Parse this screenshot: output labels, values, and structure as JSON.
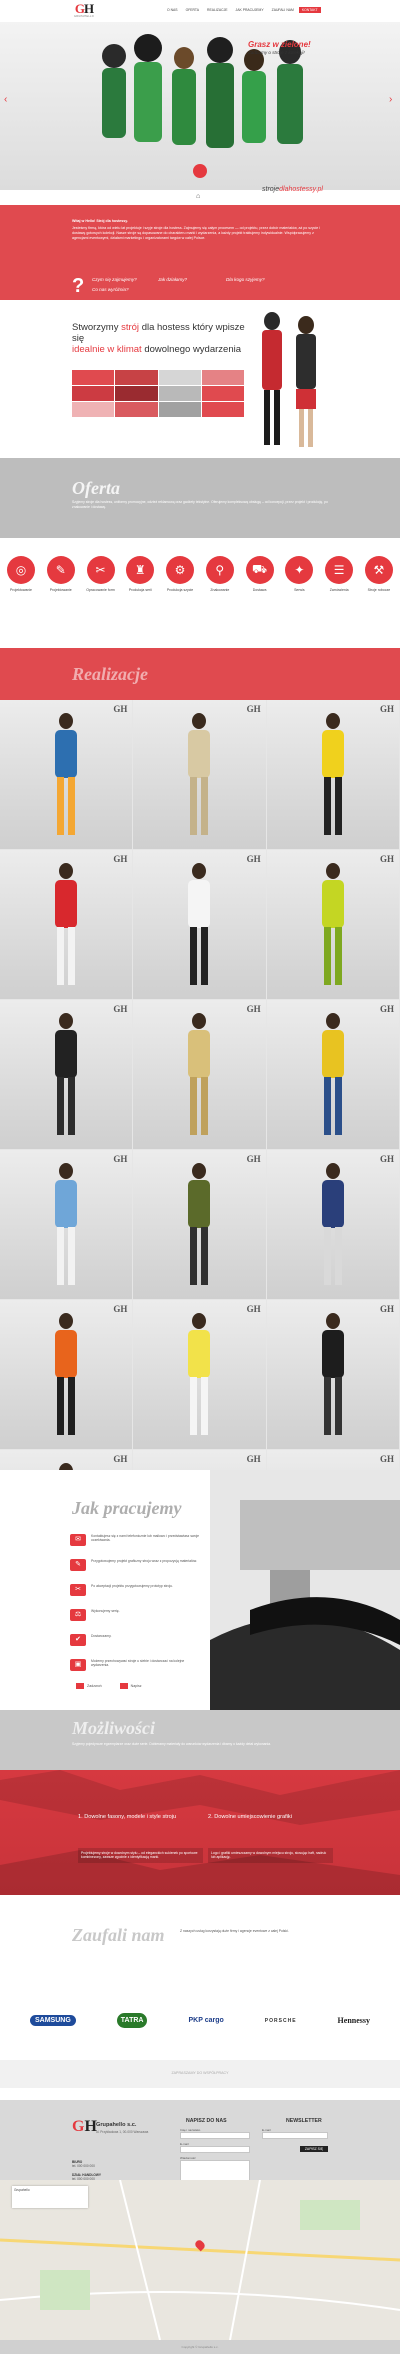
{
  "header": {
    "logo_mark_g": "G",
    "logo_mark_h": "H",
    "logo_sub": "GRUPAHELLO",
    "nav": [
      {
        "label": "O NAS",
        "active": false
      },
      {
        "label": "OFERTA",
        "active": false
      },
      {
        "label": "REALIZACJE",
        "active": false
      },
      {
        "label": "JAK PRACUJEMY",
        "active": false
      },
      {
        "label": "ZAUFALI NAM",
        "active": false
      },
      {
        "label": "KONTAKT",
        "active": true
      }
    ]
  },
  "hero": {
    "tagline_1": "Grasz w zielone!",
    "tagline_2": "Zadbamy o stroje z kolekcji!",
    "url_prefix": "stroje",
    "url_domain": "dlahostessy.pl",
    "colors": {
      "accent": "#e5393f"
    }
  },
  "intro": {
    "heading": "Witaj w Hello! Strój dla hostessy.",
    "body": "Jesteśmy firmą, która od wielu lat projektuje i szyje stroje dla hostess. Zajmujemy się całym procesem — od projektu, przez dobór materiałów, aż po szycie i dostawę gotowych kolekcji. Nasze stroje są dopasowane do charakteru marki i wydarzenia, a każdy projekt traktujemy indywidualnie. Współpracujemy z agencjami eventowymi, działami marketingu i organizatorami targów w całej Polsce.",
    "questions": [
      "Czym się zajmujemy?",
      "Jak działamy?",
      "Dla kogo szyjemy?",
      "Co nas wyróżnia?"
    ]
  },
  "tailor": {
    "title_1": "Stworzymy",
    "title_hl_1": "strój",
    "title_2": "dla hostess który wpisze się",
    "title_hl_2": "idealnie w klimat",
    "title_3": "dowolnego wydarzenia",
    "swatches": [
      "#e04a4f",
      "#c74245",
      "#d6d6d6",
      "#e58285",
      "#cc3b42",
      "#9a2b30",
      "#b9b9b9",
      "#e04a4f",
      "#efb2b4",
      "#d95a5f",
      "#a1a1a1",
      "#e04a4f"
    ]
  },
  "oferta": {
    "title": "Oferta",
    "body": "Szyjemy stroje dla hostess, uniformy promocyjne, odzież reklamową oraz gadżety tekstylne. Oferujemy kompleksową obsługę – od koncepcji, przez projekt i produkcję, po znakowanie i dostawę."
  },
  "offer_icons": [
    {
      "icon": "lifebuoy-icon",
      "glyph": "◎",
      "label": "Projektowanie"
    },
    {
      "icon": "pencil-icon",
      "glyph": "✎",
      "label": "Projektowanie"
    },
    {
      "icon": "scissors-icon",
      "glyph": "✂",
      "label": "Opracowanie form"
    },
    {
      "icon": "mannequin-icon",
      "glyph": "♜",
      "label": "Produkcja serii"
    },
    {
      "icon": "sewing-machine-icon",
      "glyph": "⚙",
      "label": "Produkcja szycie"
    },
    {
      "icon": "stamp-icon",
      "glyph": "⚲",
      "label": "Znakowanie"
    },
    {
      "icon": "delivery-icon",
      "glyph": "⛟",
      "label": "Dostawa"
    },
    {
      "icon": "pin-icon",
      "glyph": "✦",
      "label": "Serwis"
    },
    {
      "icon": "clipboard-icon",
      "glyph": "☰",
      "label": "Zamówienia"
    },
    {
      "icon": "pickaxe-icon",
      "glyph": "⚒",
      "label": "Stroje robocze"
    }
  ],
  "realizacje": {
    "title": "Realizacje",
    "tiles": [
      {
        "name": "tile-hostess-blue-orange",
        "c1": "#2d6fb0",
        "c2": "#f4a733"
      },
      {
        "name": "tile-hostess-beige-dress",
        "c1": "#d8c9a3",
        "c2": "#c4b28a"
      },
      {
        "name": "tile-hostess-yellow-black",
        "c1": "#f0d11d",
        "c2": "#222222"
      },
      {
        "name": "tile-hostess-red-racing",
        "c1": "#d8282d",
        "c2": "#f3f3f3"
      },
      {
        "name": "tile-hostess-white-black",
        "c1": "#f5f5f5",
        "c2": "#222222"
      },
      {
        "name": "tile-hostess-green-yellow",
        "c1": "#c4d623",
        "c2": "#7ea820"
      },
      {
        "name": "tile-hostess-black-dress",
        "c1": "#222222",
        "c2": "#2c2c2c"
      },
      {
        "name": "tile-hostess-gold-dress",
        "c1": "#d9c07a",
        "c2": "#bfa15c"
      },
      {
        "name": "tile-hostess-yellow-uniform",
        "c1": "#e8c321",
        "c2": "#2b4f8a"
      },
      {
        "name": "tile-hostess-blue-white",
        "c1": "#6fa6d8",
        "c2": "#f2f2f2"
      },
      {
        "name": "tile-hostess-olive-tee",
        "c1": "#5b6a2a",
        "c2": "#303030"
      },
      {
        "name": "tile-hostess-navy-track",
        "c1": "#2a3f7a",
        "c2": "#d9d9d9"
      },
      {
        "name": "tile-hostess-orange-pair",
        "c1": "#e8641c",
        "c2": "#1f1f1f"
      },
      {
        "name": "tile-hostess-yellow-pair",
        "c1": "#f2e24a",
        "c2": "#f5f5f5"
      },
      {
        "name": "tile-hostess-black-pair",
        "c1": "#1d1d1d",
        "c2": "#333333"
      },
      {
        "name": "tile-mascot-carrot",
        "c1": "#f0802b",
        "c2": "#3f9a3a"
      },
      {
        "name": "tile-pillow-gadget",
        "c1": "#6a5a64",
        "c2": "#8c7c86"
      },
      {
        "name": "tile-flag-gadget",
        "c1": "#2e8a4a",
        "c2": "#f0f0f0"
      }
    ]
  },
  "jak_pracujemy": {
    "title": "Jak pracujemy",
    "steps": [
      {
        "icon": "chat-icon",
        "text": "Kontaktujesz się z nami telefonicznie lub mailowo i przedstawiasz swoje oczekiwania."
      },
      {
        "icon": "design-icon",
        "text": "Przygotowujemy projekt graficzny stroju wraz z propozycją materiałów."
      },
      {
        "icon": "fabric-icon",
        "text": "Po akceptacji projektu przygotowujemy prototyp stroju."
      },
      {
        "icon": "measure-icon",
        "text": "Wykonujemy serię."
      },
      {
        "icon": "check-icon",
        "text": "Dostarczamy."
      },
      {
        "icon": "box-icon",
        "text": "Możemy przechowywać stroje u siebie i dostarczać na kolejne wydarzenia."
      }
    ],
    "foot_1": "Zadzwoń",
    "foot_2": "Napisz"
  },
  "mozliwosci": {
    "title": "Możliwości",
    "body": "Szyjemy pojedyncze egzemplarze oraz duże serie. Dobieramy materiały do warunków wydarzenia i dbamy o każdy detal wykonania.",
    "col_1_title": "1. Dowolne fasony, modele i style stroju",
    "col_1_text": "Projektujemy stroje w dowolnym stylu – od eleganckich sukienek po sportowe kombinezony, zawsze zgodnie z identyfikacją marki.",
    "col_2_title": "2. Dowolne umiejscowienie grafiki",
    "col_2_text": "Logo i grafiki umieszczamy w dowolnym miejscu stroju, stosując haft, nadruk lub aplikację."
  },
  "zaufali": {
    "title": "Zaufali nam",
    "body": "Z naszych usług korzystają duże firmy i agencje eventowe z całej Polski.",
    "logos": [
      "SAMSUNG",
      "TATRA",
      "PKP cargo",
      "PORSCHE",
      "Hennessy"
    ]
  },
  "note": "ZAPRASZAMY DO WSPÓŁPRACY",
  "footer": {
    "logo_g": "G",
    "logo_h": "H",
    "company": "Grupahello s.c.",
    "address": "ul. Przykładowa 1, 00-000 Warszawa",
    "contacts": [
      {
        "title": "BIURO",
        "line": "tel. 000 000 000"
      },
      {
        "title": "DZIAŁ HANDLOWY",
        "line": "tel. 000 000 000"
      },
      {
        "title": "DZIAŁ PRODUKCJI",
        "line": "tel. 000 000 000"
      }
    ],
    "contact_title": "NAPISZ DO NAS",
    "newsletter_title": "NEWSLETTER",
    "label_name": "Imię i nazwisko",
    "label_email": "E-mail",
    "label_msg": "Wiadomość",
    "send": "WYŚLIJ",
    "newsletter_email": "E-mail",
    "newsletter_btn": "ZAPISZ SIĘ",
    "map_card": "Grupahello",
    "copyright": "Copyright © Grupahello s.c."
  }
}
